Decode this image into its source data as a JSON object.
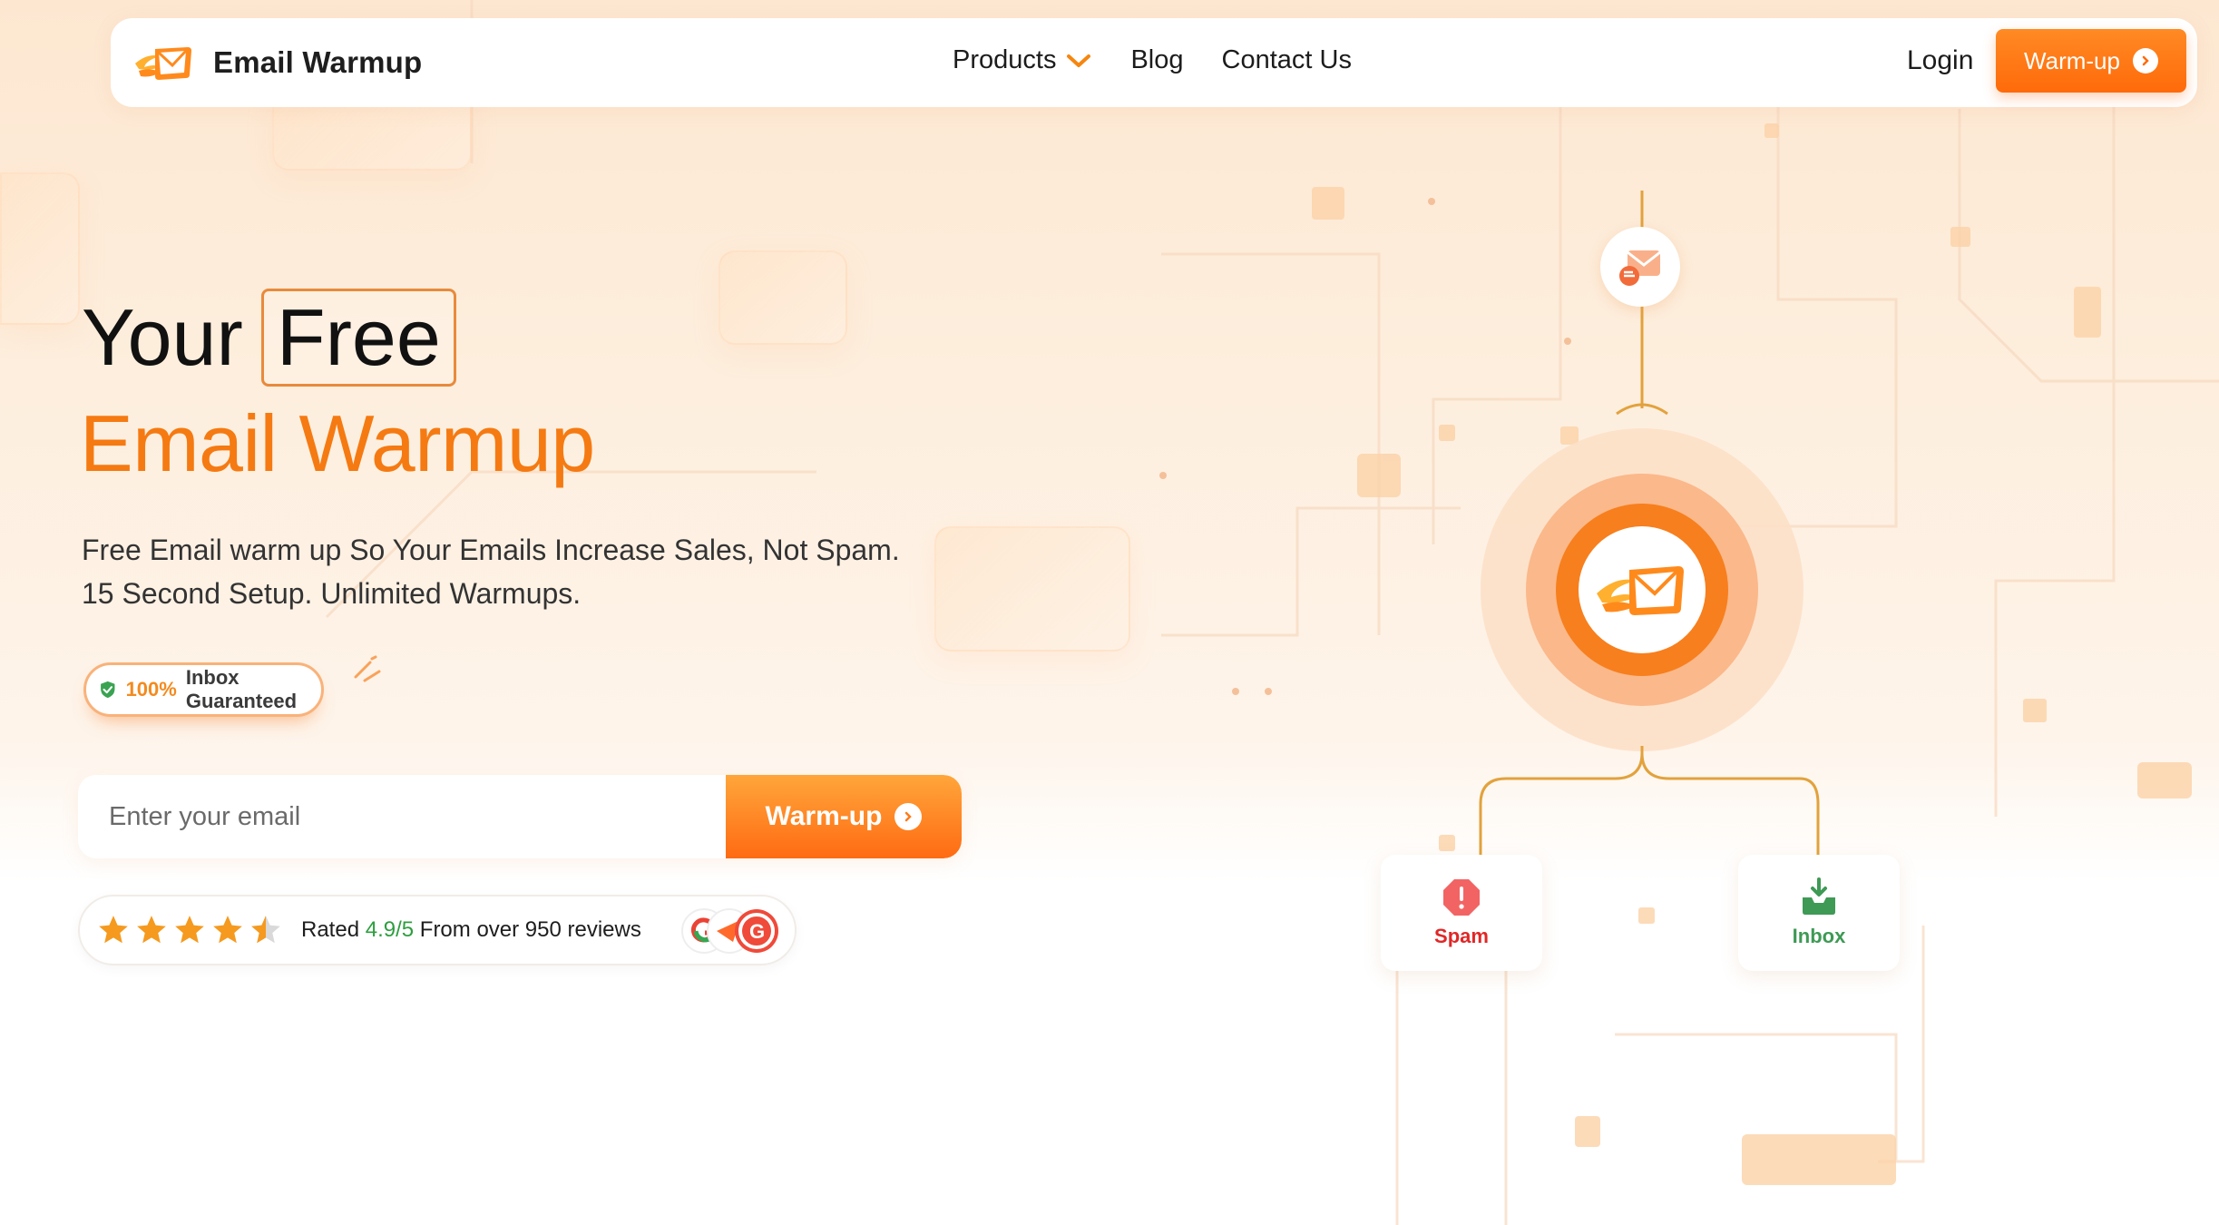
{
  "brand": {
    "name": "Email Warmup"
  },
  "nav": {
    "products": "Products",
    "blog": "Blog",
    "contact": "Contact Us",
    "login": "Login",
    "cta": "Warm-up"
  },
  "hero": {
    "title_part1": "Your",
    "title_highlight": "Free",
    "title_line2": "Email Warmup",
    "subtitle_line1": "Free Email warm up So Your Emails Increase Sales, Not Spam.",
    "subtitle_line2": "15 Second Setup. Unlimited Warmups.",
    "badge_percent": "100%",
    "badge_text": "Inbox Guaranteed"
  },
  "signup": {
    "placeholder": "Enter your email",
    "button": "Warm-up"
  },
  "rating": {
    "prefix": "Rated",
    "score": "4.9/5",
    "suffix": "From over 950 reviews",
    "stars": 4.5
  },
  "diagram": {
    "spam_label": "Spam",
    "inbox_label": "Inbox"
  },
  "colors": {
    "accent": "#f57a12",
    "button": "#ff6b12",
    "spam": "#e02727",
    "inbox": "#3e9a55"
  }
}
